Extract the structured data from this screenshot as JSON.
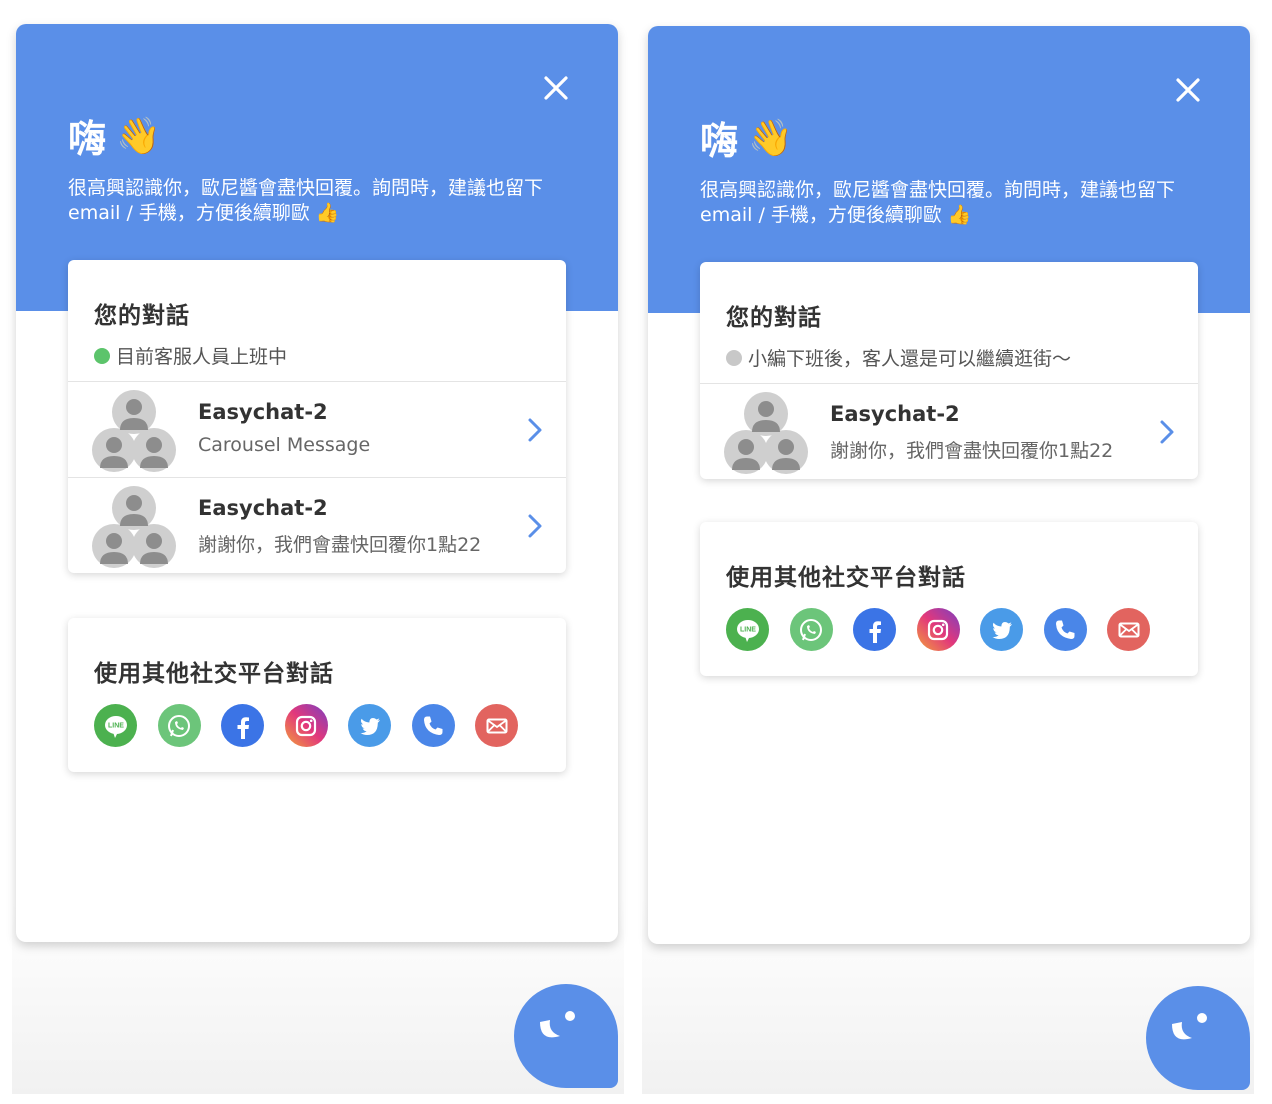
{
  "colors": {
    "brand": "#5a8fe8",
    "online": "#5cc46b",
    "offline": "#c8c8c8",
    "line": "#4cb14f",
    "whatsapp": "#6cc57a",
    "facebook": "#3b74e6",
    "twitter": "#4a9be8",
    "phone": "#4a86e8",
    "email": "#e2645f"
  },
  "left": {
    "greeting": "嗨",
    "greeting_emoji": "👋",
    "intro": "很高興認識你，歐尼醬會盡快回覆。詢問時，建議也留下 email / 手機，方便後續聊歐 👍",
    "conversations_title": "您的對話",
    "status_text": "目前客服人員上班中",
    "conversations": [
      {
        "name": "Easychat-2",
        "preview": "Carousel Message"
      },
      {
        "name": "Easychat-2",
        "preview": "謝謝你，我們會盡快回覆你1點22"
      }
    ],
    "social_title": "使用其他社交平台對話"
  },
  "right": {
    "greeting": "嗨",
    "greeting_emoji": "👋",
    "intro": "很高興認識你，歐尼醬會盡快回覆。詢問時，建議也留下 email / 手機，方便後續聊歐 👍",
    "conversations_title": "您的對話",
    "status_text": "小編下班後，客人還是可以繼續逛街～",
    "conversations": [
      {
        "name": "Easychat-2",
        "preview": "謝謝你，我們會盡快回覆你1點22"
      }
    ],
    "social_title": "使用其他社交平台對話"
  },
  "social_icons": [
    {
      "name": "line-icon",
      "label": "LINE"
    },
    {
      "name": "whatsapp-icon"
    },
    {
      "name": "facebook-icon"
    },
    {
      "name": "instagram-icon"
    },
    {
      "name": "twitter-icon"
    },
    {
      "name": "phone-icon"
    },
    {
      "name": "email-icon"
    }
  ]
}
